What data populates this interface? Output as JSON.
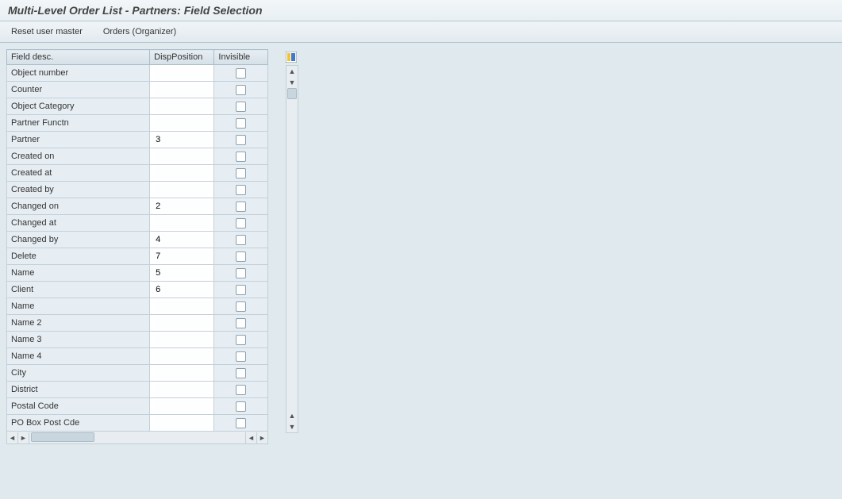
{
  "header": {
    "title": "Multi-Level Order List - Partners: Field Selection"
  },
  "toolbar": {
    "reset_label": "Reset user master",
    "orders_label": "Orders (Organizer)"
  },
  "table": {
    "columns": {
      "desc": "Field desc.",
      "pos": "DispPosition",
      "inv": "Invisible"
    },
    "rows": [
      {
        "desc": "Object number",
        "pos": "",
        "inv": false
      },
      {
        "desc": "Counter",
        "pos": "",
        "inv": false
      },
      {
        "desc": "Object Category",
        "pos": "",
        "inv": false
      },
      {
        "desc": "Partner Functn",
        "pos": "",
        "inv": false
      },
      {
        "desc": "Partner",
        "pos": "3",
        "inv": false
      },
      {
        "desc": "Created on",
        "pos": "",
        "inv": false
      },
      {
        "desc": "Created at",
        "pos": "",
        "inv": false
      },
      {
        "desc": "Created by",
        "pos": "",
        "inv": false
      },
      {
        "desc": "Changed on",
        "pos": "2",
        "inv": false
      },
      {
        "desc": "Changed at",
        "pos": "",
        "inv": false
      },
      {
        "desc": "Changed by",
        "pos": "4",
        "inv": false
      },
      {
        "desc": "Delete",
        "pos": "7",
        "inv": false
      },
      {
        "desc": "Name",
        "pos": "5",
        "inv": false
      },
      {
        "desc": "Client",
        "pos": "6",
        "inv": false
      },
      {
        "desc": "Name",
        "pos": "",
        "inv": false
      },
      {
        "desc": "Name 2",
        "pos": "",
        "inv": false
      },
      {
        "desc": "Name 3",
        "pos": "",
        "inv": false
      },
      {
        "desc": "Name 4",
        "pos": "",
        "inv": false
      },
      {
        "desc": "City",
        "pos": "",
        "inv": false
      },
      {
        "desc": "District",
        "pos": "",
        "inv": false
      },
      {
        "desc": "Postal Code",
        "pos": "",
        "inv": false
      },
      {
        "desc": "PO Box Post Cde",
        "pos": "",
        "inv": false
      }
    ]
  }
}
